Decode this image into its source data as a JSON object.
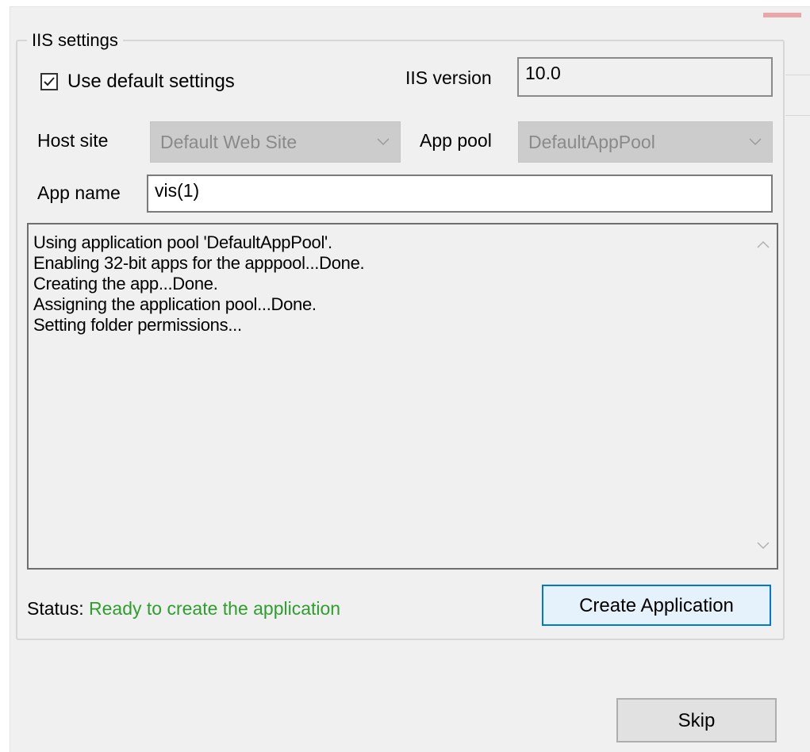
{
  "group": {
    "title": "IIS settings"
  },
  "use_default": {
    "label": "Use default settings",
    "checked": true
  },
  "iis_version": {
    "label": "IIS version",
    "value": "10.0"
  },
  "host_site": {
    "label": "Host site",
    "value": "Default Web Site"
  },
  "app_pool": {
    "label": "App pool",
    "value": "DefaultAppPool"
  },
  "app_name": {
    "label": "App name",
    "value": "vis(1)"
  },
  "log": {
    "lines": [
      "Using application pool 'DefaultAppPool'.",
      "Enabling 32-bit apps for the apppool...Done.",
      "Creating the app...Done.",
      "Assigning the application pool...Done.",
      "Setting folder permissions..."
    ]
  },
  "status": {
    "prefix": "Status:",
    "message": "Ready to create the application",
    "message_color": "#2e9e2e"
  },
  "buttons": {
    "create": "Create Application",
    "skip": "Skip"
  },
  "icons": {
    "checkbox": "checkmark-icon",
    "combo": "chevron-down-icon",
    "scroll_up": "chevron-up-icon",
    "scroll_down": "chevron-down-icon"
  }
}
